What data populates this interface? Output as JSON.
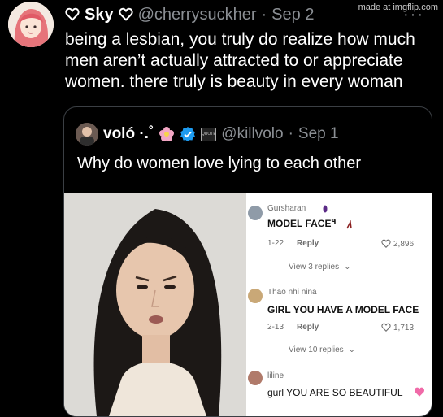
{
  "watermark": "made at imgflip.com",
  "tweet": {
    "author_name": "Sky",
    "handle": "@cherrysuckher",
    "separator": "·",
    "date": "Sep 2",
    "more": "···",
    "text": "being a lesbian, you truly do realize how much men aren’t actually attracted to or appreciate women. there truly is beauty in every woman"
  },
  "quote": {
    "author_name": "voló ·.˚",
    "handle": "@killvolo",
    "separator": "·",
    "date": "Sep 1",
    "text": "Why do women love lying to each other",
    "badge_text": "QUOTE"
  },
  "comments": [
    {
      "user": "Gursharan",
      "text": "MODEL FACE",
      "extra": "ᑫ",
      "date": "1-22",
      "reply": "Reply",
      "likes": "2,896",
      "view_replies": "View 3 replies"
    },
    {
      "user": "Thao nhi nina",
      "text": "GIRL YOU HAVE A MODEL FACE",
      "date": "2-13",
      "reply": "Reply",
      "likes": "1,713",
      "view_replies": "View 10 replies"
    },
    {
      "user": "liline",
      "text": "gurl YOU ARE SO BEAUTIFUL"
    }
  ],
  "colors": {
    "verified": "#1d9bf0",
    "background": "#000000"
  }
}
